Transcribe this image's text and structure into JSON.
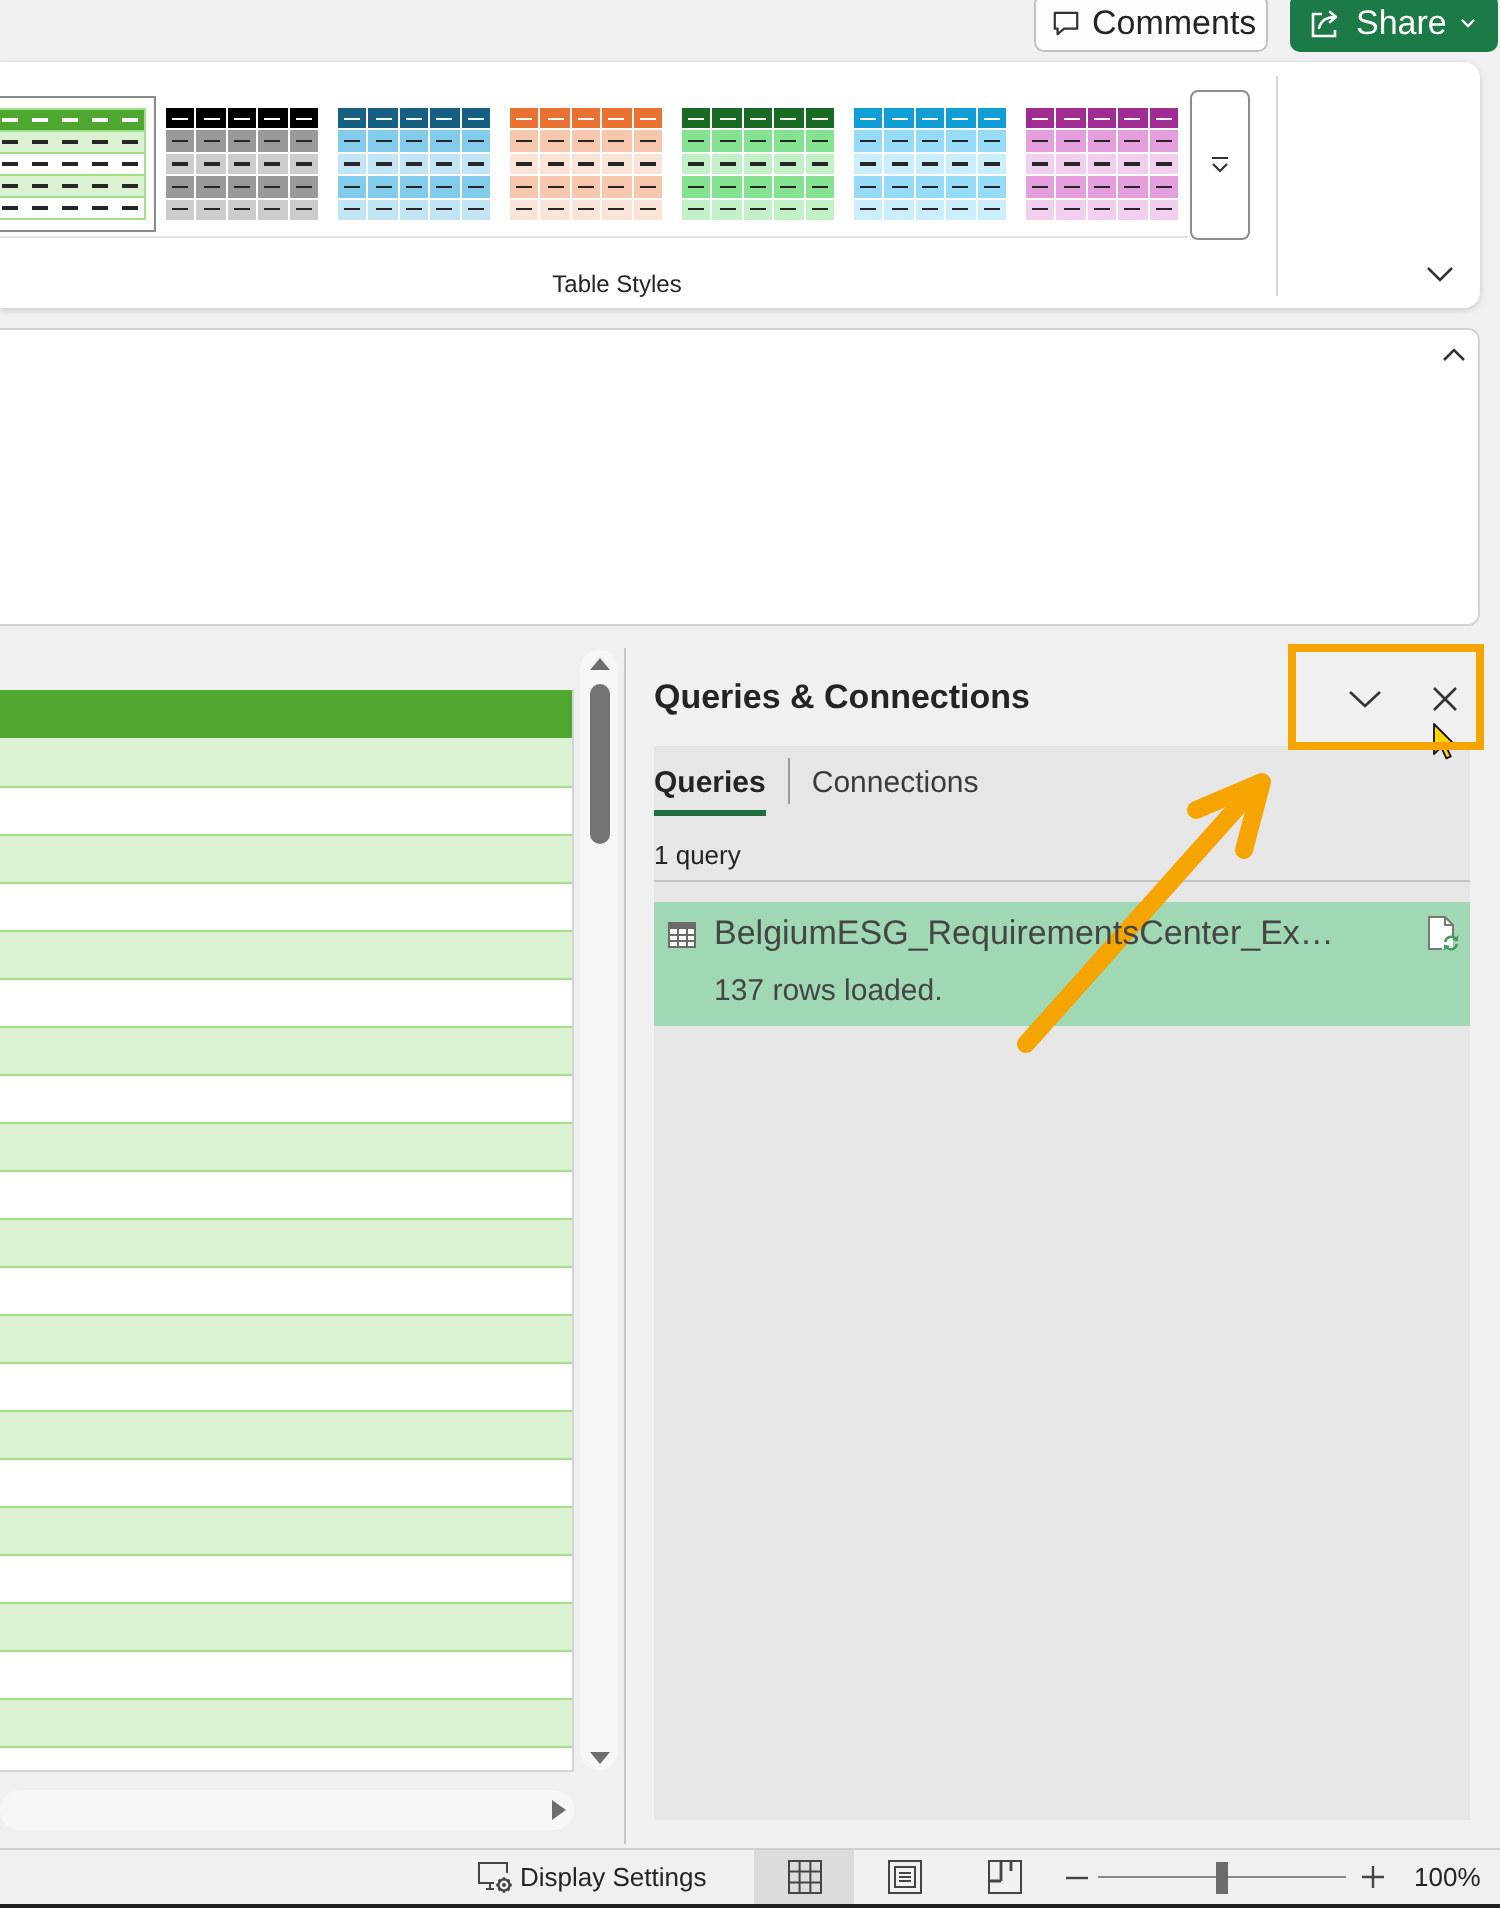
{
  "top_bar": {
    "comments": {
      "label": "Comments"
    },
    "share": {
      "label": "Share"
    }
  },
  "ribbon": {
    "table_styles": [
      {
        "kind": "lined",
        "color": "#4ea72e",
        "selected": true
      },
      {
        "kind": "banded",
        "color": "#000000",
        "selected": false
      },
      {
        "kind": "banded",
        "color": "#156082",
        "selected": false
      },
      {
        "kind": "banded",
        "color": "#e97132",
        "selected": false
      },
      {
        "kind": "banded",
        "color": "#196b24",
        "selected": false
      },
      {
        "kind": "banded",
        "color": "#0f9ed5",
        "selected": false
      },
      {
        "kind": "banded",
        "color": "#a02b93",
        "selected": false
      }
    ],
    "group_label": "Table Styles"
  },
  "queries_pane": {
    "title": "Queries & Connections",
    "tabs": [
      {
        "label": "Queries",
        "selected": true
      },
      {
        "label": "Connections",
        "selected": false
      }
    ],
    "summary": "1 query",
    "queries": [
      {
        "name": "BelgiumESG_RequirementsCenter_Ex…",
        "status": "137 rows loaded.",
        "selected": true
      }
    ]
  },
  "status_bar": {
    "display_settings": "Display Settings",
    "views": [
      {
        "kind": "normal",
        "selected": true
      },
      {
        "kind": "page_layout",
        "selected": false
      },
      {
        "kind": "page_break_preview",
        "selected": false
      }
    ],
    "zoom": {
      "level": 0.5,
      "reading": "100%"
    }
  }
}
